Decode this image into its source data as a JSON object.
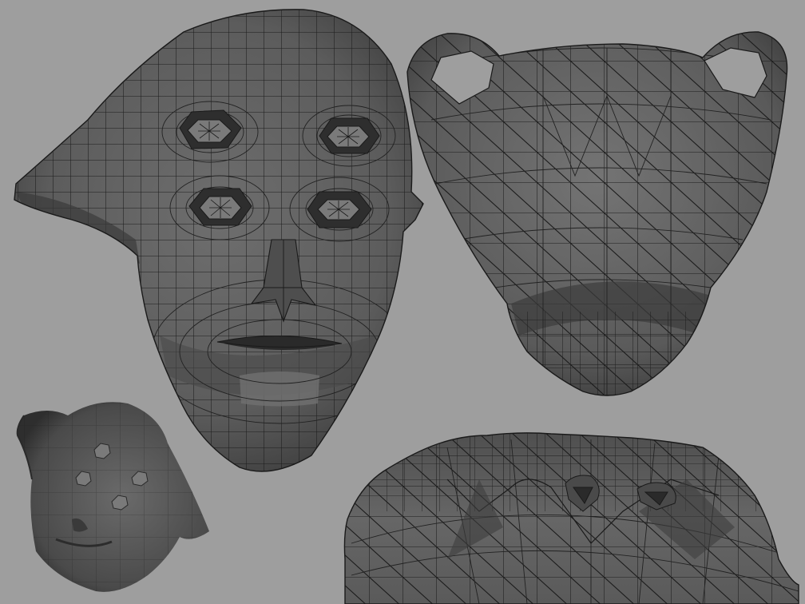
{
  "scene": {
    "background_color": "#9e9e9e",
    "mesh_base_color": "#5f5f5f",
    "mesh_dark_color": "#3a3a3a",
    "mesh_light_color": "#7a7a7a",
    "wire_color": "#1c1c1c"
  },
  "views": [
    {
      "name": "front-view",
      "icon": "head-front-mesh"
    },
    {
      "name": "top-view",
      "icon": "head-top-mesh"
    },
    {
      "name": "smoothed-three-quarter-view",
      "icon": "head-smooth-preview"
    },
    {
      "name": "bottom-closeup-view",
      "icon": "nose-underside-mesh"
    }
  ]
}
